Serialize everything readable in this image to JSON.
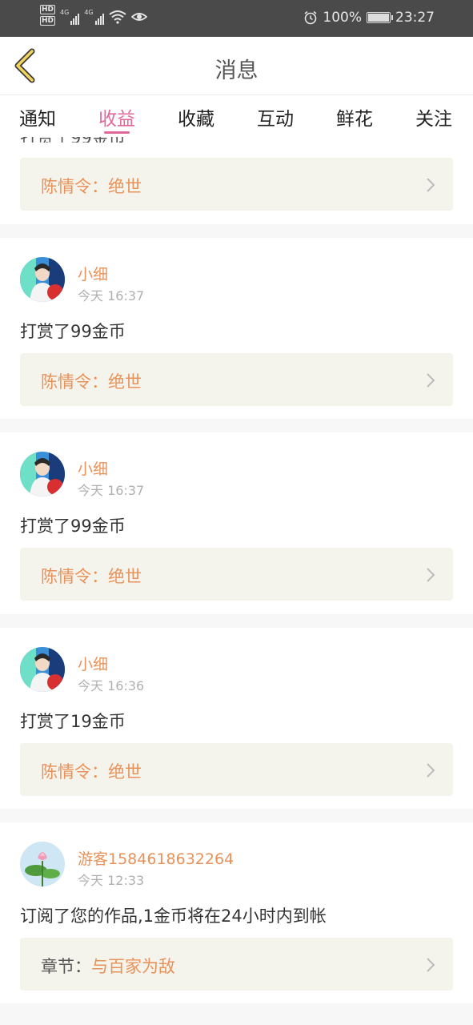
{
  "status_bar": {
    "network_1": "4G",
    "network_2": "4G",
    "battery_percent": "100%",
    "battery_level": 1.0,
    "time": "23:27"
  },
  "header": {
    "title": "消息"
  },
  "tabs": [
    {
      "label": "通知",
      "active": false
    },
    {
      "label": "收益",
      "active": true
    },
    {
      "label": "收藏",
      "active": false
    },
    {
      "label": "互动",
      "active": false
    },
    {
      "label": "鲜花",
      "active": false
    },
    {
      "label": "关注",
      "active": false
    }
  ],
  "colors": {
    "accent": "#e0679a",
    "name": "#e8925a",
    "ref_bg": "#f5f4ec"
  },
  "partial_card": {
    "ref_title": "陈情令：绝世"
  },
  "messages": [
    {
      "user": "小细",
      "time": "今天 16:37",
      "text": "打赏了99金币",
      "ref_label": "",
      "ref_title": "陈情令：绝世"
    },
    {
      "user": "小细",
      "time": "今天 16:37",
      "text": "打赏了99金币",
      "ref_label": "",
      "ref_title": "陈情令：绝世"
    },
    {
      "user": "小细",
      "time": "今天 16:36",
      "text": "打赏了19金币",
      "ref_label": "",
      "ref_title": "陈情令：绝世"
    },
    {
      "user": "游客1584618632264",
      "time": "今天 12:33",
      "text": "订阅了您的作品,1金币将在24小时内到帐",
      "ref_label": "章节：",
      "ref_title": "与百家为敌"
    }
  ]
}
